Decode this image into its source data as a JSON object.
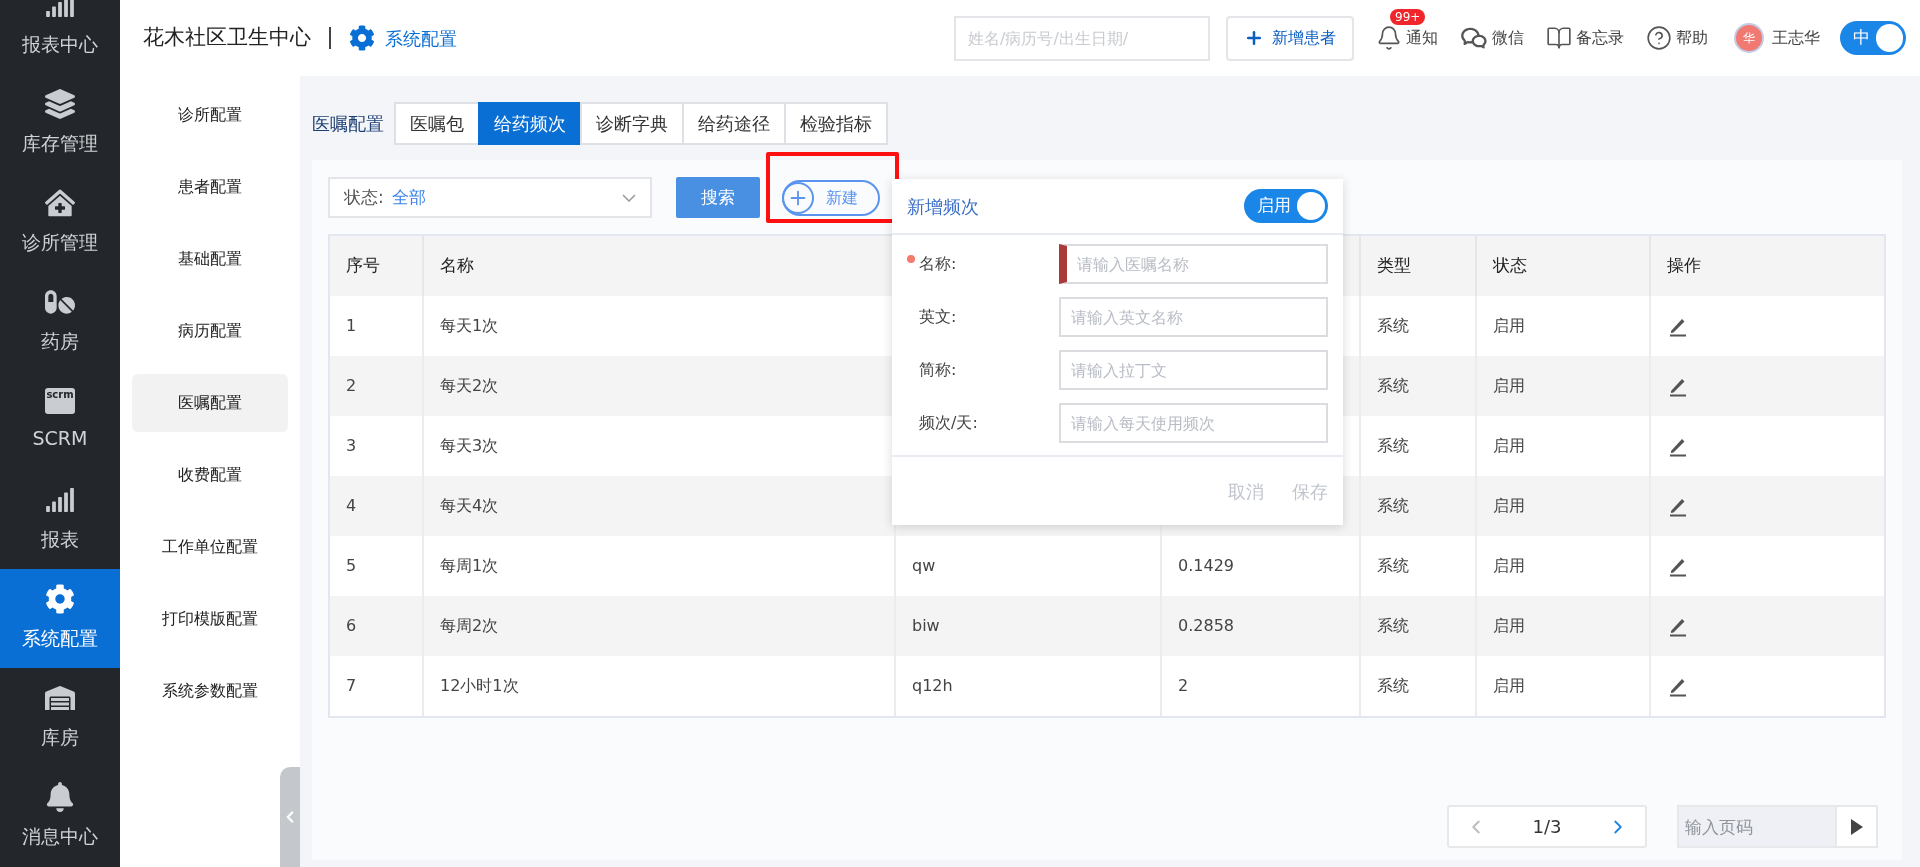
{
  "nav": {
    "items": [
      {
        "label": "报表中心",
        "kind": "bars",
        "selected": false
      },
      {
        "label": "库存管理",
        "kind": "layers",
        "selected": false
      },
      {
        "label": "诊所管理",
        "kind": "clinic",
        "selected": false
      },
      {
        "label": "药房",
        "kind": "pills",
        "selected": false
      },
      {
        "label": "SCRM",
        "kind": "tag",
        "icon_text": "scrm",
        "selected": false
      },
      {
        "label": "报表",
        "kind": "bars",
        "selected": false
      },
      {
        "label": "系统配置",
        "kind": "gear",
        "selected": true
      },
      {
        "label": "库房",
        "kind": "warehouse",
        "selected": false
      },
      {
        "label": "消息中心",
        "kind": "bell",
        "selected": false
      }
    ]
  },
  "header": {
    "title": "花木社区卫生中心",
    "section": "系统配置",
    "search": {
      "placeholder": "姓名/病历号/出生日期/"
    },
    "new_patient": "新增患者",
    "actions": [
      {
        "label": "通知",
        "kind": "bell",
        "badge": "99+"
      },
      {
        "label": "微信",
        "kind": "wechat"
      },
      {
        "label": "备忘录",
        "kind": "book"
      },
      {
        "label": "帮助",
        "kind": "help"
      }
    ],
    "user": {
      "avatar": "华",
      "name": "王志华"
    },
    "lang_toggle": {
      "label": "中",
      "on": true
    }
  },
  "subnav": {
    "items": [
      {
        "label": "诊所配置",
        "selected": false
      },
      {
        "label": "患者配置",
        "selected": false
      },
      {
        "label": "基础配置",
        "selected": false
      },
      {
        "label": "病历配置",
        "selected": false
      },
      {
        "label": "医嘱配置",
        "selected": true
      },
      {
        "label": "收费配置",
        "selected": false
      },
      {
        "label": "工作单位配置",
        "selected": false
      },
      {
        "label": "打印模版配置",
        "selected": false
      },
      {
        "label": "系统参数配置",
        "selected": false
      }
    ]
  },
  "tabs": {
    "label": "医嘱配置",
    "items": [
      {
        "label": "医嘱包",
        "selected": false
      },
      {
        "label": "给药频次",
        "selected": true
      },
      {
        "label": "诊断字典",
        "selected": false
      },
      {
        "label": "给药途径",
        "selected": false
      },
      {
        "label": "检验指标",
        "selected": false
      }
    ]
  },
  "filter": {
    "status_label": "状态:",
    "status_value": "全部",
    "search_button": "搜索",
    "new_button": "新建"
  },
  "table": {
    "columns": [
      {
        "label": "序号",
        "kind": "text"
      },
      {
        "label": "名称",
        "kind": "text"
      },
      {
        "kind": "text"
      },
      {
        "kind": "text"
      },
      {
        "label": "类型",
        "kind": "text"
      },
      {
        "label": "状态",
        "kind": "text"
      },
      {
        "label": "操作",
        "kind": "edit"
      }
    ],
    "rows": [
      {
        "no": "1",
        "name": "每天1次",
        "type": "系统",
        "status": "启用"
      },
      {
        "no": "2",
        "name": "每天2次",
        "type": "系统",
        "status": "启用"
      },
      {
        "no": "3",
        "name": "每天3次",
        "type": "系统",
        "status": "启用"
      },
      {
        "no": "4",
        "name": "每天4次",
        "type": "系统",
        "status": "启用"
      },
      {
        "no": "5",
        "name": "每周1次",
        "column_3": "qw",
        "column_4": "0.1429",
        "type": "系统",
        "status": "启用"
      },
      {
        "no": "6",
        "name": "每周2次",
        "column_3": "biw",
        "column_4": "0.2858",
        "type": "系统",
        "status": "启用"
      },
      {
        "no": "7",
        "name": "12小时1次",
        "column_3": "q12h",
        "column_4": "2",
        "type": "系统",
        "status": "启用"
      }
    ]
  },
  "popover": {
    "title": "新增频次",
    "toggle": {
      "label": "启用",
      "on": true
    },
    "fields": [
      {
        "label": "名称:",
        "placeholder": "请输入医嘱名称",
        "required": true,
        "invalid": true
      },
      {
        "label": "英文:",
        "placeholder": "请输入英文名称",
        "required": false,
        "invalid": false
      },
      {
        "label": "简称:",
        "placeholder": "请输入拉丁文",
        "required": false,
        "invalid": false
      },
      {
        "label": "频次/天:",
        "placeholder": "请输入每天使用频次",
        "required": false,
        "invalid": false
      }
    ],
    "buttons": [
      {
        "label": "取消",
        "disabled": true
      },
      {
        "label": "保存",
        "disabled": true
      }
    ]
  },
  "pagination": {
    "page": "1/3",
    "prev_disabled": true,
    "next_disabled": false,
    "jump_placeholder": "输入页码"
  }
}
